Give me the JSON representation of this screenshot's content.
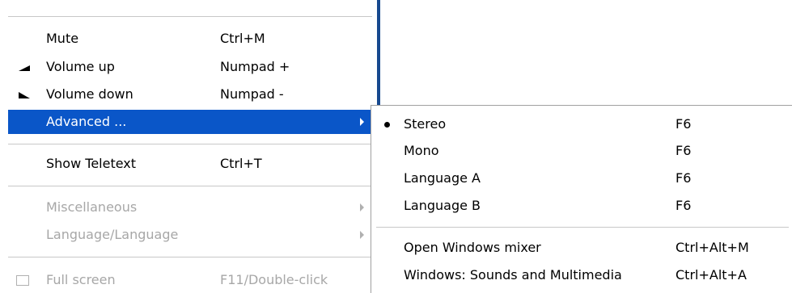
{
  "main_menu": {
    "items": [
      {
        "label": "Mute",
        "shortcut": "Ctrl+M"
      },
      {
        "label": "Volume up",
        "shortcut": "Numpad +",
        "icon": "volume-up-icon"
      },
      {
        "label": "Volume down",
        "shortcut": "Numpad -",
        "icon": "volume-down-icon"
      },
      {
        "label": "Advanced ...",
        "shortcut": "",
        "submenu": true,
        "highlighted": true
      },
      {
        "label": "Show Teletext",
        "shortcut": "Ctrl+T"
      },
      {
        "label": "Miscellaneous",
        "shortcut": "",
        "submenu": true,
        "disabled": true
      },
      {
        "label": "Language/Language",
        "shortcut": "",
        "submenu": true,
        "disabled": true
      },
      {
        "label": "Full screen",
        "shortcut": "F11/Double-click",
        "disabled": true,
        "icon": "fullscreen-icon"
      }
    ]
  },
  "sub_menu": {
    "items": [
      {
        "label": "Stereo",
        "shortcut": "F6",
        "checked": true
      },
      {
        "label": "Mono",
        "shortcut": "F6"
      },
      {
        "label": "Language A",
        "shortcut": "F6"
      },
      {
        "label": "Language B",
        "shortcut": "F6"
      },
      {
        "label": "Open Windows mixer",
        "shortcut": "Ctrl+Alt+M"
      },
      {
        "label": "Windows: Sounds and Multimedia",
        "shortcut": "Ctrl+Alt+A"
      }
    ]
  },
  "colors": {
    "highlight": "#0a56c8",
    "disabled_text": "#a7a7a7",
    "edge": "#17498f"
  }
}
